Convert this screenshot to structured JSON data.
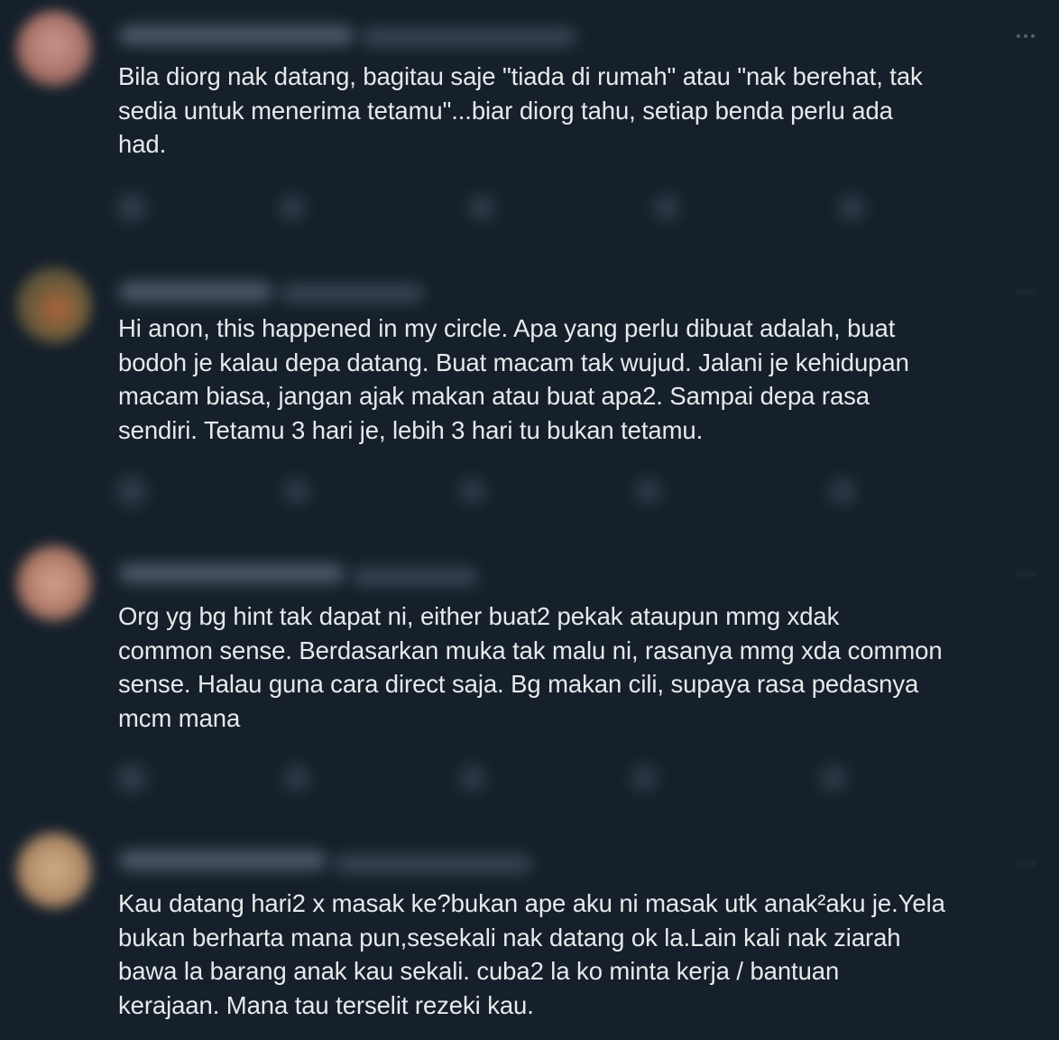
{
  "colors": {
    "background": "#15202b",
    "text": "#e7e9ea",
    "muted": "#8b98a5"
  },
  "replies": [
    {
      "text": "Bila diorg nak datang, bagitau saje \"tiada di rumah\" atau \"nak berehat, tak\nsedia untuk menerima tetamu\"...biar diorg tahu, setiap benda perlu ada\nhad."
    },
    {
      "text": "Hi anon, this happened in my circle. Apa yang perlu dibuat adalah, buat\nbodoh je kalau depa datang. Buat macam tak wujud. Jalani je kehidupan\nmacam biasa, jangan ajak makan atau buat apa2. Sampai depa rasa\nsendiri. Tetamu 3 hari je, lebih 3 hari tu bukan tetamu."
    },
    {
      "text": "Org yg bg hint tak dapat ni, either buat2 pekak ataupun mmg xdak\ncommon sense. Berdasarkan muka tak malu ni, rasanya mmg xda common\nsense. Halau guna cara direct saja. Bg makan cili, supaya rasa pedasnya\nmcm mana"
    },
    {
      "text": "Kau datang hari2 x masak ke?bukan ape aku ni masak utk anak²aku je.Yela\nbukan berharta mana pun,sesekali nak datang ok la.Lain kali nak ziarah\nbawa la barang anak kau sekali. cuba2 la ko minta kerja / bantuan\nkerajaan. Mana tau terselit rezeki kau."
    }
  ],
  "icons": {
    "more": "more-horizontal-icon",
    "reply": "reply-icon",
    "retweet": "retweet-icon",
    "like": "like-icon",
    "views": "views-icon",
    "bookmark": "bookmark-icon",
    "share": "share-icon"
  }
}
